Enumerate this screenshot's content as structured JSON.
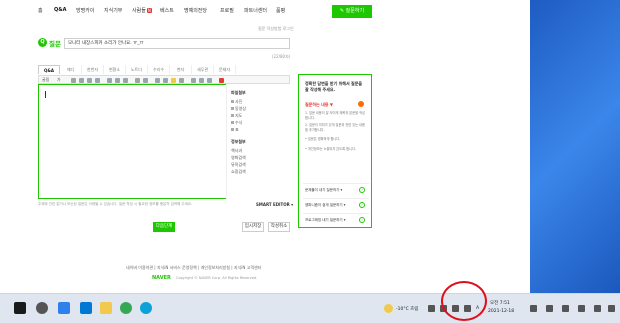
{
  "nav": {
    "items": [
      {
        "label": "홈",
        "active": false
      },
      {
        "label": "Q&A",
        "active": true
      },
      {
        "label": "방명카이",
        "active": false
      },
      {
        "label": "지식기부",
        "active": false
      },
      {
        "label": "사람들",
        "active": false,
        "badge": "N"
      },
      {
        "label": "베스트",
        "active": false
      },
      {
        "label": "명예의전당",
        "active": false
      },
      {
        "label": "프로필",
        "active": false
      },
      {
        "label": "파트너센터",
        "active": false
      },
      {
        "label": "품평",
        "active": false
      }
    ],
    "ask_button": "✎ 질문하기"
  },
  "question": {
    "util_text": "질문 작성방법 로그인",
    "label": "질문",
    "q_mark": "Q",
    "title_value": "모니터 내장스피커 소리가 안나요. ㅠ_ㅠ",
    "counter": "(22/80자)"
  },
  "editor": {
    "tabs": [
      "Q&A",
      "에디",
      "한번자",
      "변환소",
      "노트다",
      "수리수",
      "변자",
      "세무관",
      "문제자"
    ],
    "toolbar": {
      "font": "굴림",
      "size": "가",
      "icons": [
        "bold-icon",
        "italic-icon",
        "underline-icon",
        "strike-icon",
        "align-left-icon",
        "align-center-icon",
        "align-right-icon",
        "list-icon",
        "table-icon",
        "image-icon",
        "link-icon",
        "emoji-icon",
        "search-icon"
      ]
    },
    "side_panel": {
      "head1": "파일첨부",
      "items1": [
        "사진",
        "동영상",
        "지도",
        "수식",
        "표"
      ],
      "head2": "정보첨부",
      "items2": [
        "책사과",
        "영화검색",
        "뮤직검색",
        "쇼핑검색"
      ]
    }
  },
  "notice": "주제와 관련 없거나 모순된 질문은 삭제될 수 있습니다. 질문 작성 시 필요한 정보를 충분히 입력해 주세요.",
  "smart_editor": "SMART EDITOR ▾",
  "buttons": {
    "register": "다음단계",
    "temp_save": "임시저장",
    "cancel": "작성취소"
  },
  "help": {
    "title": "정확한 답변을 받기 위해서 질문을 잘 작성해 주세요.",
    "subtitle": "질문하는 내용 ▼",
    "lines": [
      "1. 질문 내용이 잘 보이게 제목과 본문을 작성합니다.",
      "2. 질문이 의미가 있게 질문과 관련 있는 내용을 추가합니다.",
      "• 질문은 명확하게 합니다.",
      "• 개인정보는 노출되지 않도록 합니다."
    ],
    "links": [
      {
        "label": "문제풀이 내기 질문하기 ▾",
        "badge": "N"
      },
      {
        "label": "엠파니즘이 쉽게 질문하기 ▾"
      },
      {
        "label": "프로그래밍 내기 질문하기 ▾"
      }
    ]
  },
  "footer": {
    "links": "네이버 이용약관 | 지식iN 서비스 운영정책 | 개인정보처리방침 | 지식iN 고객센터",
    "logo": "NAVER",
    "copyright": "Copyright © NAVER Corp. All Rights Reserved."
  },
  "taskbar": {
    "weather": "-10°C 흐림",
    "time": "오전 7:51",
    "date": "2021-12-18",
    "lang": "A",
    "colors": {
      "start": "#1a1a1a",
      "explorer": "#f2c94c",
      "store": "#2f80ed",
      "mail": "#0078d4",
      "chrome": "#34a853",
      "opera": "#e53935",
      "edge": "#0aa2d8"
    }
  }
}
